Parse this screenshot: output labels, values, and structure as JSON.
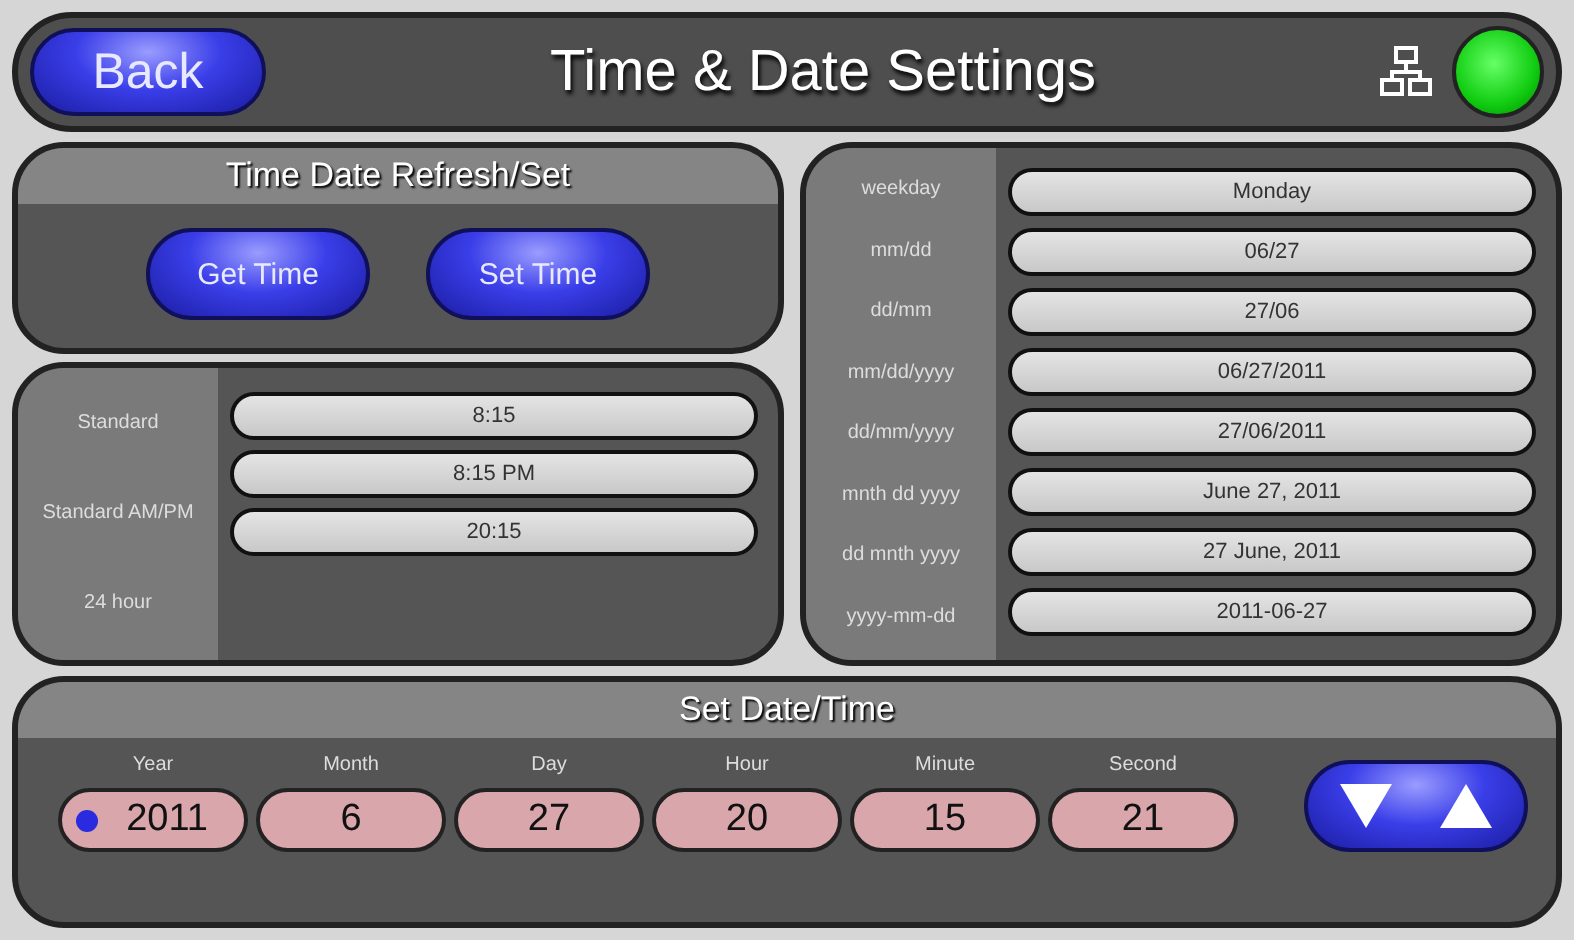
{
  "header": {
    "back_button": "Back",
    "title": "Time & Date Settings",
    "status_light": {
      "on": true
    }
  },
  "refresh_panel": {
    "title": "Time Date Refresh/Set",
    "buttons": [
      "Get Time",
      "Set Time"
    ]
  },
  "time_formats": [
    {
      "label": "Standard",
      "value": "8:15"
    },
    {
      "label": "Standard AM/PM",
      "value": "8:15 PM"
    },
    {
      "label": "24 hour",
      "value": "20:15"
    }
  ],
  "date_formats": [
    {
      "label": "weekday",
      "value": "Monday"
    },
    {
      "label": "mm/dd",
      "value": "06/27"
    },
    {
      "label": "dd/mm",
      "value": "27/06"
    },
    {
      "label": "mm/dd/yyyy",
      "value": "06/27/2011"
    },
    {
      "label": "dd/mm/yyyy",
      "value": "27/06/2011"
    },
    {
      "label": "mnth dd yyyy",
      "value": "June 27, 2011"
    },
    {
      "label": "dd mnth yyyy",
      "value": "27 June, 2011"
    },
    {
      "label": "yyyy-mm-dd",
      "value": "2011-06-27"
    }
  ],
  "set_panel": {
    "title": "Set Date/Time",
    "fields": [
      {
        "label": "Year",
        "value": "2011",
        "selected": true
      },
      {
        "label": "Month",
        "value": "6",
        "selected": false
      },
      {
        "label": "Day",
        "value": "27",
        "selected": false
      },
      {
        "label": "Hour",
        "value": "20",
        "selected": false
      },
      {
        "label": "Minute",
        "value": "15",
        "selected": false
      },
      {
        "label": "Second",
        "value": "21",
        "selected": false
      }
    ]
  }
}
